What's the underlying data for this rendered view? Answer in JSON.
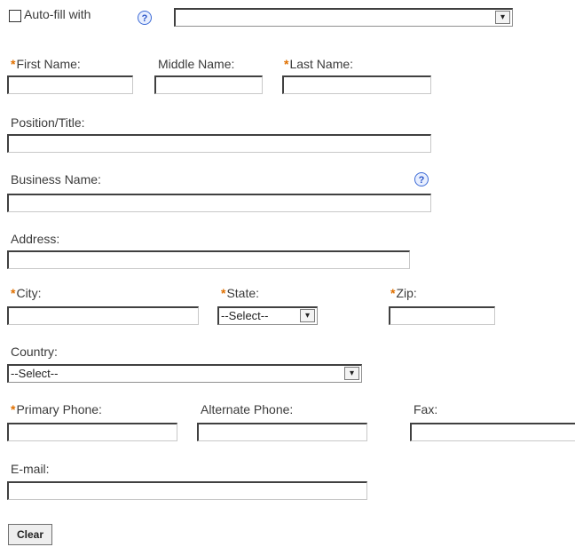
{
  "autofill": {
    "checkbox_label": "Auto-fill with",
    "help_icon": "question-icon",
    "select_value": ""
  },
  "labels": {
    "first_name": "First Name:",
    "middle_name": "Middle Name:",
    "last_name": "Last Name:",
    "position": "Position/Title:",
    "business_name": "Business Name:",
    "address": "Address:",
    "city": "City:",
    "state": "State:",
    "zip": "Zip:",
    "country": "Country:",
    "primary_phone": "Primary Phone:",
    "alternate_phone": "Alternate Phone:",
    "fax": "Fax:",
    "email": "E-mail:"
  },
  "required_marker": "*",
  "values": {
    "first_name": "",
    "middle_name": "",
    "last_name": "",
    "position": "",
    "business_name": "",
    "address": "",
    "city": "",
    "zip": "",
    "primary_phone": "",
    "alternate_phone": "",
    "fax": "",
    "email": ""
  },
  "selects": {
    "state": "--Select--",
    "country": "--Select--"
  },
  "icons": {
    "dropdown_arrow": "▾",
    "help": "?"
  },
  "buttons": {
    "clear": "Clear"
  },
  "colors": {
    "required": "#e07000",
    "help_icon": "#2a55c8"
  }
}
